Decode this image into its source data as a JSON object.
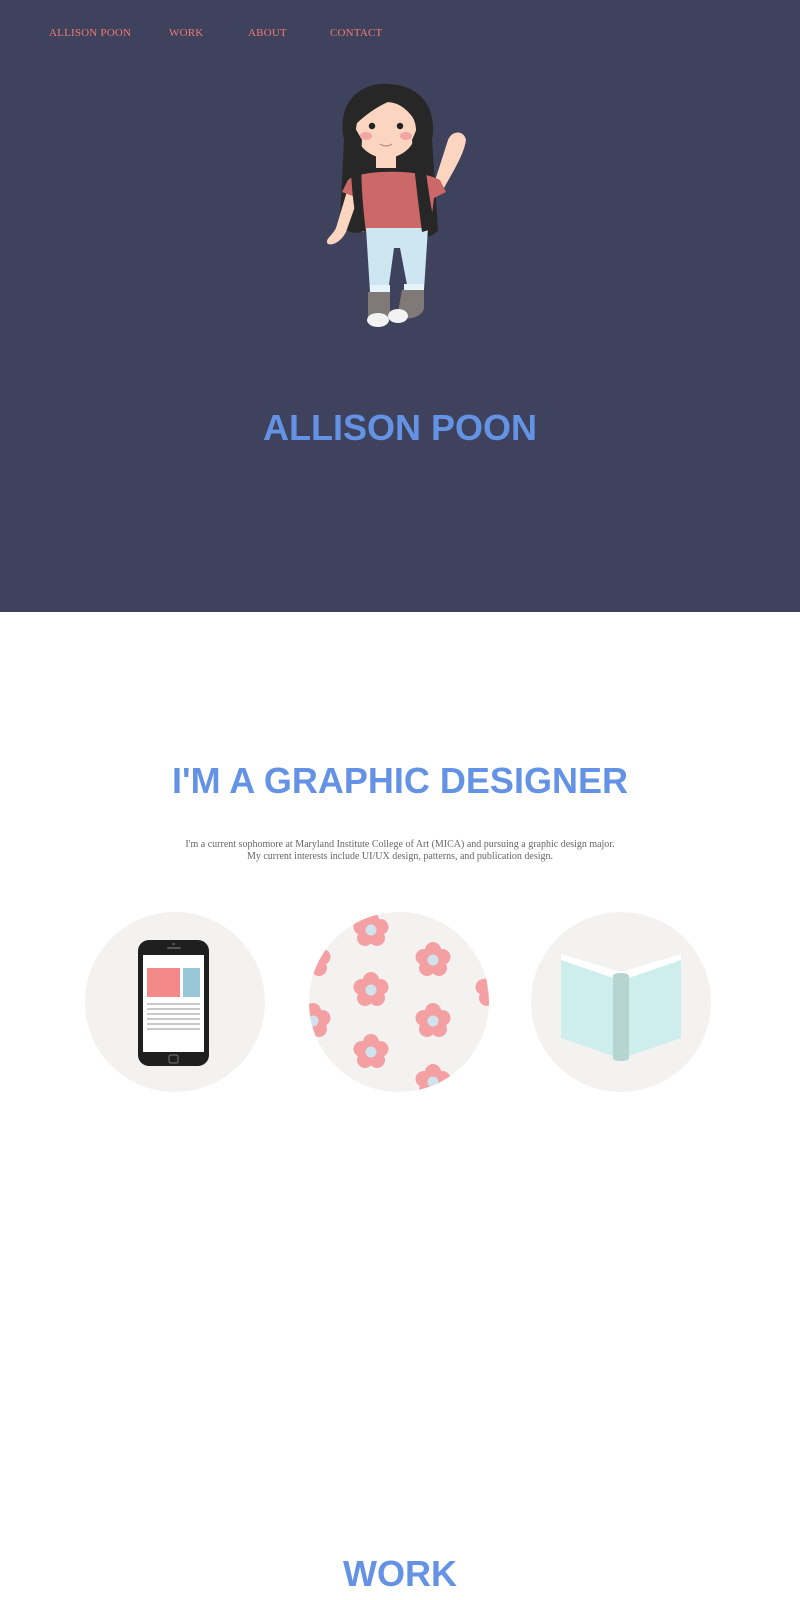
{
  "nav": {
    "items": [
      {
        "label": "ALLISON POON"
      },
      {
        "label": "WORK"
      },
      {
        "label": "ABOUT"
      },
      {
        "label": "CONTACT"
      }
    ]
  },
  "hero": {
    "title": "ALLISON POON",
    "avatar_icon": "girl-waving-illustration"
  },
  "about": {
    "title": "I'M A GRAPHIC DESIGNER",
    "line1": "I'm a current sophomore at Maryland Institute College of Art (MICA) and pursuing a graphic design major.",
    "line2": "My current interests include UI/UX design, patterns, and publication design.",
    "interests": [
      {
        "icon": "smartphone-ui-icon"
      },
      {
        "icon": "flower-pattern-icon"
      },
      {
        "icon": "open-book-icon"
      }
    ]
  },
  "work": {
    "title": "WORK"
  },
  "colors": {
    "hero_bg": "#3e425c",
    "accent_blue": "#6492e4",
    "nav_coral": "#f07a76",
    "circle_bg": "#f3f2f0"
  }
}
